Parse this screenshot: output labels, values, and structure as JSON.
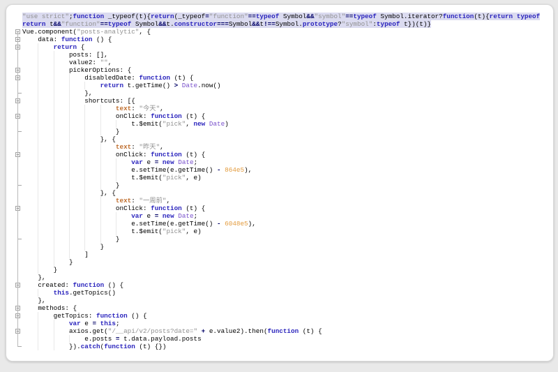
{
  "editor": {
    "language": "javascript",
    "selection_color": "#dbdbf0",
    "token_styles": {
      "k": {
        "color": "#2a24bd",
        "bold": true
      },
      "o": {
        "color": "#000066",
        "bold": true
      },
      "s": {
        "color": "#909090",
        "bold": false
      },
      "n": {
        "color": "#e39b3d",
        "bold": false
      },
      "c": {
        "color": "#7a52cc",
        "bold": false
      },
      "pr": {
        "color": "#bf6e2e",
        "bold": true
      },
      "p": {
        "color": "#000000",
        "bold": false
      }
    },
    "lines": [
      {
        "n": 1,
        "indent": 0,
        "selected": true,
        "fold": false,
        "tokens": [
          [
            "s",
            "\"use strict\""
          ],
          [
            "p",
            ";"
          ],
          [
            "k",
            "function"
          ],
          [
            "p",
            " _typeof(t){"
          ],
          [
            "k",
            "return"
          ],
          [
            "p",
            "(_typeof"
          ],
          [
            "o",
            "="
          ],
          [
            "s",
            "\"function\""
          ],
          [
            "o",
            "=="
          ],
          [
            "k",
            "typeof"
          ],
          [
            "p",
            " Symbol"
          ],
          [
            "o",
            "&&"
          ],
          [
            "s",
            "\"symbol\""
          ],
          [
            "o",
            "=="
          ],
          [
            "k",
            "typeof"
          ],
          [
            "p",
            " Symbol.iterator?"
          ],
          [
            "k",
            "function"
          ],
          [
            "p",
            "(t){"
          ],
          [
            "k",
            "return"
          ],
          [
            "p",
            " "
          ],
          [
            "k",
            "typeof"
          ]
        ]
      },
      {
        "n": 2,
        "indent": 0,
        "selected": true,
        "fold": false,
        "tokens": [
          [
            "k",
            "return"
          ],
          [
            "p",
            " t"
          ],
          [
            "o",
            "&&"
          ],
          [
            "s",
            "\"function\""
          ],
          [
            "o",
            "=="
          ],
          [
            "k",
            "typeof"
          ],
          [
            "p",
            " Symbol"
          ],
          [
            "o",
            "&&"
          ],
          [
            "p",
            "t."
          ],
          [
            "k",
            "constructor"
          ],
          [
            "o",
            "==="
          ],
          [
            "p",
            "Symbol"
          ],
          [
            "o",
            "&&"
          ],
          [
            "p",
            "t"
          ],
          [
            "o",
            "!=="
          ],
          [
            "p",
            "Symbol."
          ],
          [
            "k",
            "prototype"
          ],
          [
            "p",
            "?"
          ],
          [
            "s",
            "\"symbol\""
          ],
          [
            "p",
            ":"
          ],
          [
            "k",
            "typeof"
          ],
          [
            "p",
            " t})(t)}"
          ]
        ]
      },
      {
        "n": 3,
        "indent": 0,
        "fold": true,
        "tokens": [
          [
            "p",
            "Vue.component("
          ],
          [
            "s",
            "\"posts-analytic\""
          ],
          [
            "p",
            ", {"
          ]
        ]
      },
      {
        "n": 4,
        "indent": 1,
        "fold": true,
        "tokens": [
          [
            "p",
            "data: "
          ],
          [
            "k",
            "function"
          ],
          [
            "p",
            " () {"
          ]
        ]
      },
      {
        "n": 5,
        "indent": 2,
        "fold": true,
        "tokens": [
          [
            "k",
            "return"
          ],
          [
            "p",
            " {"
          ]
        ]
      },
      {
        "n": 6,
        "indent": 3,
        "tokens": [
          [
            "p",
            "posts: [],"
          ]
        ]
      },
      {
        "n": 7,
        "indent": 3,
        "tokens": [
          [
            "p",
            "value2: "
          ],
          [
            "s",
            "\"\""
          ],
          [
            "p",
            ","
          ]
        ]
      },
      {
        "n": 8,
        "indent": 3,
        "fold": true,
        "tokens": [
          [
            "p",
            "pickerOptions: {"
          ]
        ]
      },
      {
        "n": 9,
        "indent": 4,
        "fold": true,
        "tokens": [
          [
            "p",
            "disabledDate: "
          ],
          [
            "k",
            "function"
          ],
          [
            "p",
            " (t) {"
          ]
        ]
      },
      {
        "n": 10,
        "indent": 5,
        "tokens": [
          [
            "k",
            "return"
          ],
          [
            "p",
            " t.getTime() "
          ],
          [
            "o",
            ">"
          ],
          [
            "p",
            " "
          ],
          [
            "c",
            "Date"
          ],
          [
            "p",
            ".now()"
          ]
        ]
      },
      {
        "n": 11,
        "indent": 4,
        "tick": true,
        "tokens": [
          [
            "p",
            "},"
          ]
        ]
      },
      {
        "n": 12,
        "indent": 4,
        "fold": true,
        "tokens": [
          [
            "p",
            "shortcuts: [{"
          ]
        ]
      },
      {
        "n": 13,
        "indent": 6,
        "tokens": [
          [
            "pr",
            "text"
          ],
          [
            "p",
            ": "
          ],
          [
            "s",
            "\"今天\""
          ],
          [
            "p",
            ","
          ]
        ]
      },
      {
        "n": 14,
        "indent": 6,
        "fold": true,
        "tokens": [
          [
            "p",
            "onClick: "
          ],
          [
            "k",
            "function"
          ],
          [
            "p",
            " (t) {"
          ]
        ]
      },
      {
        "n": 15,
        "indent": 7,
        "tokens": [
          [
            "p",
            "t.$emit("
          ],
          [
            "s",
            "\"pick\""
          ],
          [
            "p",
            ", "
          ],
          [
            "k",
            "new"
          ],
          [
            "p",
            " "
          ],
          [
            "c",
            "Date"
          ],
          [
            "p",
            ")"
          ]
        ]
      },
      {
        "n": 16,
        "indent": 6,
        "tick": true,
        "tokens": [
          [
            "p",
            "}"
          ]
        ]
      },
      {
        "n": 17,
        "indent": 5,
        "tokens": [
          [
            "p",
            "}, {"
          ]
        ]
      },
      {
        "n": 18,
        "indent": 6,
        "tokens": [
          [
            "pr",
            "text"
          ],
          [
            "p",
            ": "
          ],
          [
            "s",
            "\"昨天\""
          ],
          [
            "p",
            ","
          ]
        ]
      },
      {
        "n": 19,
        "indent": 6,
        "fold": true,
        "tokens": [
          [
            "p",
            "onClick: "
          ],
          [
            "k",
            "function"
          ],
          [
            "p",
            " (t) {"
          ]
        ]
      },
      {
        "n": 20,
        "indent": 7,
        "tokens": [
          [
            "k",
            "var"
          ],
          [
            "p",
            " e "
          ],
          [
            "o",
            "="
          ],
          [
            "p",
            " "
          ],
          [
            "k",
            "new"
          ],
          [
            "p",
            " "
          ],
          [
            "c",
            "Date"
          ],
          [
            "p",
            ";"
          ]
        ]
      },
      {
        "n": 21,
        "indent": 7,
        "tokens": [
          [
            "p",
            "e.setTime(e.getTime() "
          ],
          [
            "o",
            "-"
          ],
          [
            "p",
            " "
          ],
          [
            "n",
            "864e5"
          ],
          [
            "p",
            "),"
          ]
        ]
      },
      {
        "n": 22,
        "indent": 7,
        "tokens": [
          [
            "p",
            "t.$emit("
          ],
          [
            "s",
            "\"pick\""
          ],
          [
            "p",
            ", e)"
          ]
        ]
      },
      {
        "n": 23,
        "indent": 6,
        "tick": true,
        "tokens": [
          [
            "p",
            "}"
          ]
        ]
      },
      {
        "n": 24,
        "indent": 5,
        "tokens": [
          [
            "p",
            "}, {"
          ]
        ]
      },
      {
        "n": 25,
        "indent": 6,
        "tokens": [
          [
            "pr",
            "text"
          ],
          [
            "p",
            ": "
          ],
          [
            "s",
            "\"一周前\""
          ],
          [
            "p",
            ","
          ]
        ]
      },
      {
        "n": 26,
        "indent": 6,
        "fold": true,
        "tokens": [
          [
            "p",
            "onClick: "
          ],
          [
            "k",
            "function"
          ],
          [
            "p",
            " (t) {"
          ]
        ]
      },
      {
        "n": 27,
        "indent": 7,
        "tokens": [
          [
            "k",
            "var"
          ],
          [
            "p",
            " e "
          ],
          [
            "o",
            "="
          ],
          [
            "p",
            " "
          ],
          [
            "k",
            "new"
          ],
          [
            "p",
            " "
          ],
          [
            "c",
            "Date"
          ],
          [
            "p",
            ";"
          ]
        ]
      },
      {
        "n": 28,
        "indent": 7,
        "tokens": [
          [
            "p",
            "e.setTime(e.getTime() "
          ],
          [
            "o",
            "-"
          ],
          [
            "p",
            " "
          ],
          [
            "n",
            "6048e5"
          ],
          [
            "p",
            "),"
          ]
        ]
      },
      {
        "n": 29,
        "indent": 7,
        "tokens": [
          [
            "p",
            "t.$emit("
          ],
          [
            "s",
            "\"pick\""
          ],
          [
            "p",
            ", e)"
          ]
        ]
      },
      {
        "n": 30,
        "indent": 6,
        "tick": true,
        "tokens": [
          [
            "p",
            "}"
          ]
        ]
      },
      {
        "n": 31,
        "indent": 5,
        "tokens": [
          [
            "p",
            "}"
          ]
        ]
      },
      {
        "n": 32,
        "indent": 4,
        "tokens": [
          [
            "p",
            "]"
          ]
        ]
      },
      {
        "n": 33,
        "indent": 3,
        "tokens": [
          [
            "p",
            "}"
          ]
        ]
      },
      {
        "n": 34,
        "indent": 2,
        "tokens": [
          [
            "p",
            "}"
          ]
        ]
      },
      {
        "n": 35,
        "indent": 1,
        "tokens": [
          [
            "p",
            "},"
          ]
        ]
      },
      {
        "n": 36,
        "indent": 1,
        "fold": true,
        "tokens": [
          [
            "p",
            "created: "
          ],
          [
            "k",
            "function"
          ],
          [
            "p",
            " () {"
          ]
        ]
      },
      {
        "n": 37,
        "indent": 2,
        "tokens": [
          [
            "k",
            "this"
          ],
          [
            "p",
            ".getTopics()"
          ]
        ]
      },
      {
        "n": 38,
        "indent": 1,
        "tokens": [
          [
            "p",
            "},"
          ]
        ]
      },
      {
        "n": 39,
        "indent": 1,
        "fold": true,
        "tokens": [
          [
            "p",
            "methods: {"
          ]
        ]
      },
      {
        "n": 40,
        "indent": 2,
        "fold": true,
        "tokens": [
          [
            "p",
            "getTopics: "
          ],
          [
            "k",
            "function"
          ],
          [
            "p",
            " () {"
          ]
        ]
      },
      {
        "n": 41,
        "indent": 3,
        "tokens": [
          [
            "k",
            "var"
          ],
          [
            "p",
            " e "
          ],
          [
            "o",
            "="
          ],
          [
            "p",
            " "
          ],
          [
            "k",
            "this"
          ],
          [
            "p",
            ";"
          ]
        ]
      },
      {
        "n": 42,
        "indent": 3,
        "fold": true,
        "tokens": [
          [
            "p",
            "axios.get("
          ],
          [
            "s",
            "\"/__api/v2/posts?date=\""
          ],
          [
            "p",
            " "
          ],
          [
            "o",
            "+"
          ],
          [
            "p",
            " e.value2).then("
          ],
          [
            "k",
            "function"
          ],
          [
            "p",
            " (t) {"
          ]
        ]
      },
      {
        "n": 43,
        "indent": 4,
        "tokens": [
          [
            "p",
            "e.posts "
          ],
          [
            "o",
            "="
          ],
          [
            "p",
            " t.data.payload.posts"
          ]
        ]
      },
      {
        "n": 44,
        "indent": 3,
        "tick": true,
        "tokens": [
          [
            "p",
            "})."
          ],
          [
            "k",
            "catch"
          ],
          [
            "p",
            "("
          ],
          [
            "k",
            "function"
          ],
          [
            "p",
            " (t) {})"
          ]
        ]
      }
    ]
  }
}
